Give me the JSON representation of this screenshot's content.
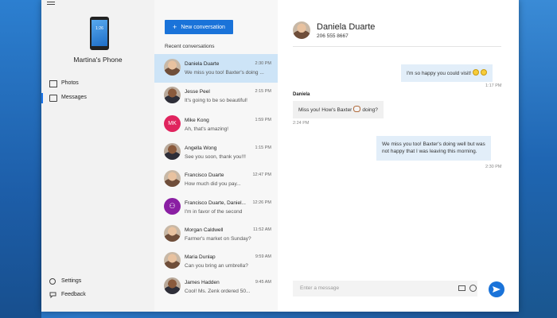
{
  "nav": {
    "phone_clock": "1:26",
    "phone_name": "Martina's Phone",
    "items": [
      {
        "label": "Photos",
        "icon": "photo-icon"
      },
      {
        "label": "Messages",
        "icon": "message-icon"
      }
    ],
    "bottom": [
      {
        "label": "Settings",
        "icon": "gear-icon"
      },
      {
        "label": "Feedback",
        "icon": "feedback-icon"
      }
    ]
  },
  "list": {
    "new_button": "New conversation",
    "recent_heading": "Recent conversations",
    "conversations": [
      {
        "name": "Daniela Duarte",
        "time": "2:30 PM",
        "preview": "We miss you too! Baxter's doing ..."
      },
      {
        "name": "Jesse Peel",
        "time": "2:15 PM",
        "preview": "It's going to be so beautiful!"
      },
      {
        "name": "Mike Kong",
        "time": "1:59 PM",
        "preview": "Ah, that's amazing!",
        "initials": "MK"
      },
      {
        "name": "Angella Wong",
        "time": "1:15 PM",
        "preview": "See you soon, thank you!!!"
      },
      {
        "name": "Francisco Duarte",
        "time": "12:47 PM",
        "preview": "How much did you pay..."
      },
      {
        "name": "Francisco Duarte, Daniel...",
        "time": "12:26 PM",
        "preview": "I'm in favor of the second"
      },
      {
        "name": "Morgan Caldwell",
        "time": "11:52 AM",
        "preview": "Farmer's market on Sunday?"
      },
      {
        "name": "Maria Dunlap",
        "time": "9:59 AM",
        "preview": "Can you bring an umbrella?"
      },
      {
        "name": "James Hadden",
        "time": "9:45 AM",
        "preview": "Cool! Ms. Zenk ordered 50..."
      }
    ]
  },
  "chat": {
    "contact_name": "Daniela Duarte",
    "contact_number": "206 555 8667",
    "messages": [
      {
        "text": "I'm so happy you could visit!",
        "time": "1:17 PM"
      },
      {
        "sender": "Daniela",
        "text_before": "Miss you! How's Baxter",
        "text_after": "doing?",
        "time": "2:24 PM"
      },
      {
        "line1": "We miss you too! Baxter's doing well but was",
        "line2": "not happy that I was leaving this morning.",
        "time": "2:30 PM"
      }
    ],
    "compose_placeholder": "Enter a message"
  },
  "colors": {
    "accent": "#1a73d9",
    "active_row": "#cde4f7",
    "sent_bubble": "#e2eef9"
  }
}
